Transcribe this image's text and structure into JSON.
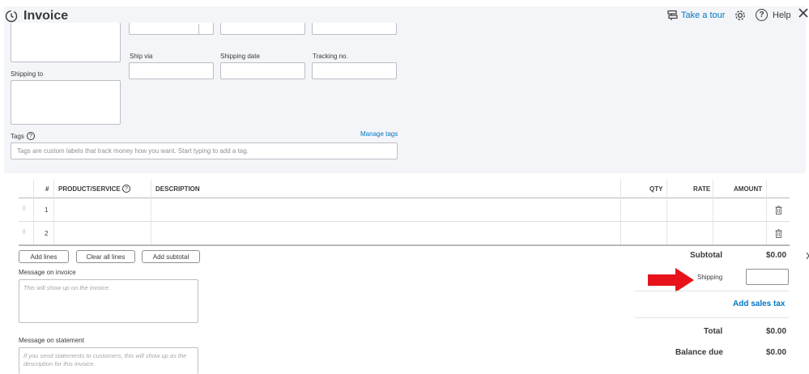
{
  "header": {
    "title": "Invoice",
    "take_tour": "Take a tour",
    "help": "Help"
  },
  "form": {
    "ship_via_label": "Ship via",
    "shipping_date_label": "Shipping date",
    "tracking_no_label": "Tracking no.",
    "shipping_to_label": "Shipping to",
    "tags_label": "Tags",
    "manage_tags": "Manage tags",
    "tags_placeholder": "Tags are custom labels that track money how you want. Start typing to add a tag."
  },
  "table": {
    "columns": [
      "#",
      "PRODUCT/SERVICE",
      "DESCRIPTION",
      "QTY",
      "RATE",
      "AMOUNT"
    ],
    "rows": [
      {
        "num": "1"
      },
      {
        "num": "2"
      }
    ]
  },
  "buttons": {
    "add_lines": "Add lines",
    "clear_all_lines": "Clear all lines",
    "add_subtotal": "Add subtotal"
  },
  "messages": {
    "invoice_label": "Message on invoice",
    "invoice_placeholder": "This will show up on the invoice.",
    "statement_label": "Message on statement",
    "statement_placeholder": "If you send statements to customers, this will show up as the description for this invoice."
  },
  "totals": {
    "subtotal_label": "Subtotal",
    "subtotal_value": "$0.00",
    "shipping_label": "Shipping",
    "add_sales_tax": "Add sales tax",
    "total_label": "Total",
    "total_value": "$0.00",
    "balance_due_label": "Balance due",
    "balance_due_value": "$0.00"
  },
  "colors": {
    "accent": "#0077c5",
    "panel_bg": "#f4f5f8",
    "annotation_arrow": "#e8121b"
  }
}
